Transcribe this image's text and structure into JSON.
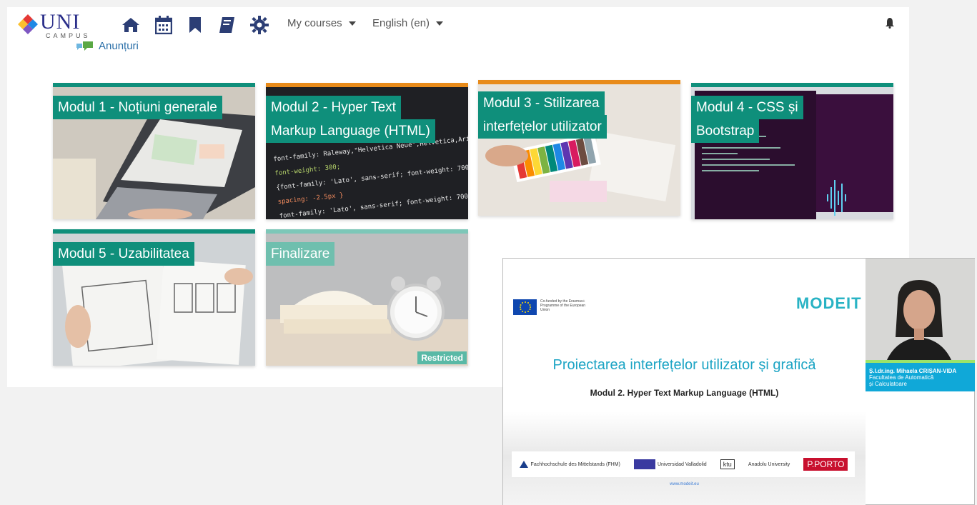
{
  "navbar": {
    "logo_text": "UNI",
    "logo_subtext": "CAMPUS",
    "icons": [
      "home-icon",
      "calendar-icon",
      "bookmark-icon",
      "book-icon",
      "gear-icon"
    ],
    "my_courses": "My courses",
    "language": "English (en)"
  },
  "announcements": "Anunțuri",
  "modules": [
    {
      "title_lines": [
        "Modul 1 - Noțiuni generale"
      ],
      "image": "laptop-wireframe"
    },
    {
      "title_lines": [
        "Modul 2 - Hyper Text",
        "Markup Language (HTML)"
      ],
      "image": "code-screen"
    },
    {
      "title_lines": [
        "Modul 3 - Stilizarea",
        "interfețelor utilizator"
      ],
      "image": "color-swatches"
    },
    {
      "title_lines": [
        "Modul 4 - CSS și",
        "Bootstrap"
      ],
      "image": "monitors-code"
    },
    {
      "title_lines": [
        "Modul 5 - Uzabilitatea"
      ],
      "image": "paper-mockups"
    },
    {
      "title_lines": [
        "Finalizare"
      ],
      "image": "book-alarm-clock",
      "badge": "Restricted"
    }
  ],
  "video": {
    "eu_text": "Co-funded by the Erasmus+ Programme of the European Union",
    "brand": "MODEIT",
    "slide_title": "Proiectarea interfețelor utilizator și grafică",
    "slide_subtitle": "Modul 2. Hyper Text Markup Language (HTML)",
    "partners": [
      "Fachhochschule des Mittelstands (FHM)",
      "Universidad Valladolid",
      "ktu",
      "Anadolu University",
      "P.PORTO"
    ],
    "link": "www.modeit.eu",
    "speaker_name": "Ș.l.dr.ing. Mihaela CRIȘAN-VIDA",
    "speaker_affiliation_1": "Facultatea de Automatică",
    "speaker_affiliation_2": "și Calculatoare"
  }
}
